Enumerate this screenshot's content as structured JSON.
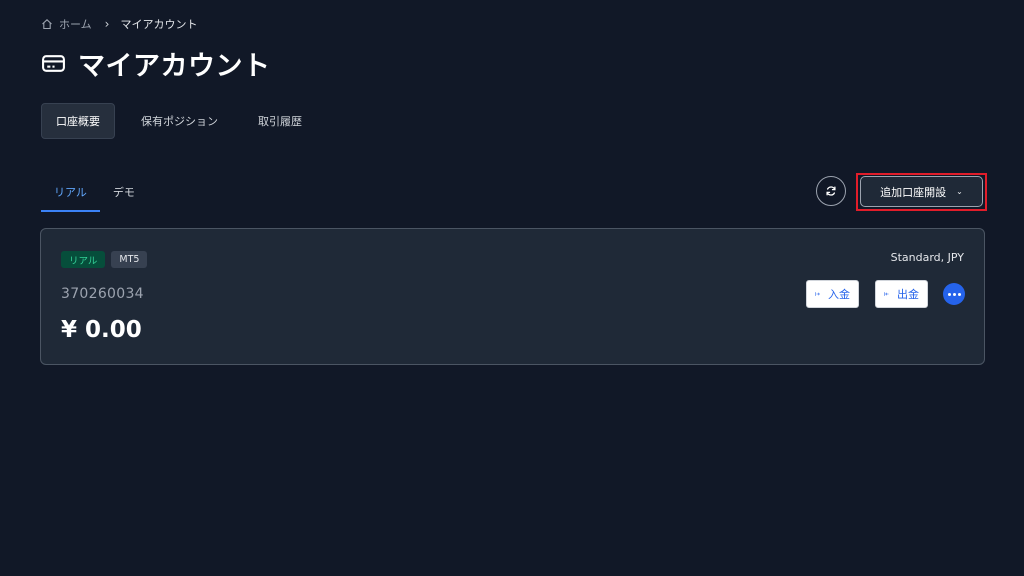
{
  "breadcrumb": {
    "home_label": "ホーム",
    "separator": "›",
    "current": "マイアカウント"
  },
  "page": {
    "title": "マイアカウント",
    "title_icon": "credit-card-icon"
  },
  "top_tabs": [
    {
      "label": "口座概要",
      "active": true
    },
    {
      "label": "保有ポジション",
      "active": false
    },
    {
      "label": "取引履歴",
      "active": false
    }
  ],
  "sub_tabs": [
    {
      "label": "リアル",
      "active": true
    },
    {
      "label": "デモ",
      "active": false
    }
  ],
  "actions": {
    "refresh_icon": "refresh-icon",
    "open_account_label": "追加口座開設",
    "open_account_chevron": "⌄"
  },
  "account": {
    "badge_real": "リアル",
    "badge_platform": "MT5",
    "type": "Standard, JPY",
    "number": "370260034",
    "balance": "¥ 0.00",
    "deposit_label": "入金",
    "withdraw_label": "出金",
    "more_icon": "more-horizontal-icon"
  },
  "colors": {
    "background": "#111827",
    "card": "#1f2937",
    "accent": "#3b82f6",
    "highlight": "#e11d2a",
    "real_badge": "#064e3b"
  }
}
